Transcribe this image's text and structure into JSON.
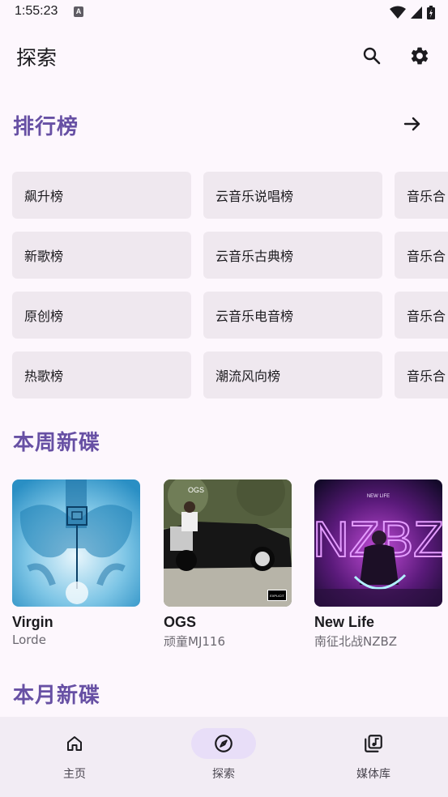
{
  "status_bar": {
    "time": "1:55:23",
    "notification_glyph": "A"
  },
  "header": {
    "title": "探索"
  },
  "charts_section": {
    "title": "排行榜",
    "rows": [
      [
        "飙升榜",
        "云音乐说唱榜",
        "音乐合"
      ],
      [
        "新歌榜",
        "云音乐古典榜",
        "音乐合"
      ],
      [
        "原创榜",
        "云音乐电音榜",
        "音乐合"
      ],
      [
        "热歌榜",
        "潮流风向榜",
        "音乐合"
      ]
    ]
  },
  "weekly_section": {
    "title": "本周新碟",
    "albums": [
      {
        "title": "Virgin",
        "artist": "Lorde"
      },
      {
        "title": "OGS",
        "artist": "顽童MJ116",
        "cover_text": "OGS",
        "badge": "EXPLICIT"
      },
      {
        "title": "New Life",
        "artist": "南征北战NZBZ",
        "cover_text": "NEW LIFE",
        "cover_big": "NZBZ"
      }
    ]
  },
  "monthly_section": {
    "title": "本月新碟"
  },
  "bottom_nav": {
    "items": [
      {
        "label": "主页",
        "icon": "home-icon",
        "active": false
      },
      {
        "label": "探索",
        "icon": "compass-icon",
        "active": true
      },
      {
        "label": "媒体库",
        "icon": "library-icon",
        "active": false
      }
    ]
  },
  "colors": {
    "accent": "#6750a4",
    "background": "#fdf7fd",
    "chip": "#efe8ef",
    "nav_bg": "#f2ecf4",
    "nav_active": "#e8def8"
  }
}
